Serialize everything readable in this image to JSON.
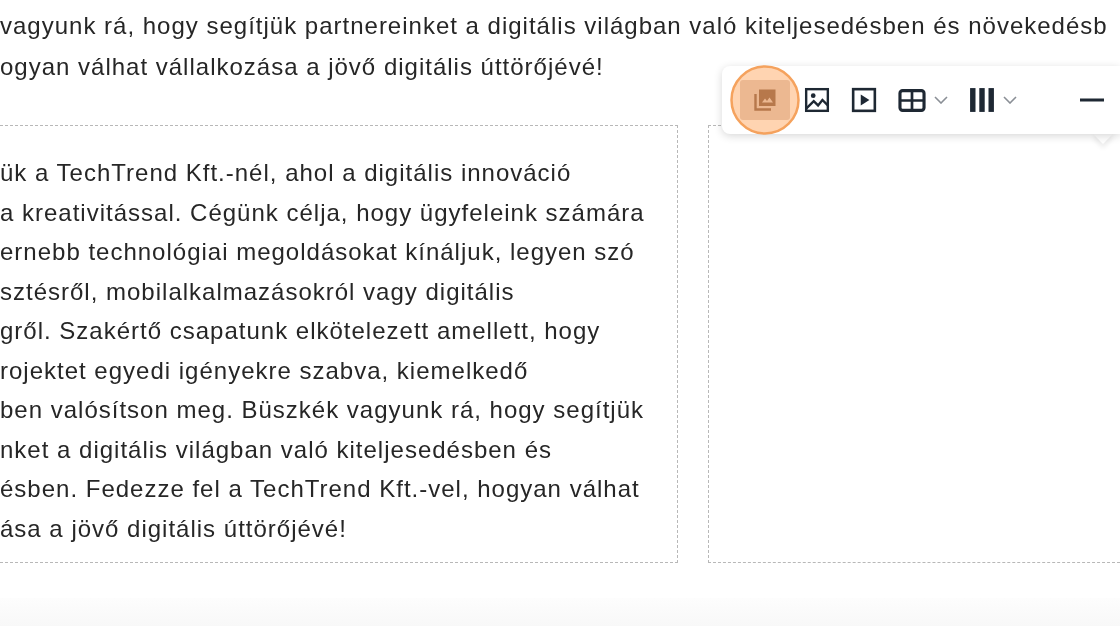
{
  "intro_lines": [
    "vagyunk rá, hogy segítjük partnereinket a digitális világban való kiteljesedésben és növekedésb",
    "ogyan válhat vállalkozása a jövő digitális úttörőjévé!"
  ],
  "columns": [
    {
      "kind": "text",
      "lines": [
        "ük a TechTrend Kft.-nél, ahol a digitális innováció",
        "a kreativitással. Cégünk célja, hogy ügyfeleink számára",
        "ernebb technológiai megoldásokat kínáljuk, legyen szó",
        "sztésről, mobilalkalmazásokról vagy digitális",
        "gről. Szakértő csapatunk elkötelezett amellett, hogy",
        "rojektet egyedi igényekre szabva, kiemelkedő",
        "ben valósítson meg. Büszkék vagyunk rá, hogy segítjük",
        "nket a digitális világban való kiteljesedésben és",
        "ésben. Fedezze fel a TechTrend Kft.-vel, hogyan válhat",
        "ása a jövő digitális úttörőjévé!"
      ]
    },
    {
      "kind": "empty"
    }
  ],
  "toolbar": {
    "items": [
      {
        "kind": "gallery",
        "selected": true,
        "highlighted": true,
        "dropdown": false
      },
      {
        "kind": "image",
        "selected": false,
        "highlighted": false,
        "dropdown": false
      },
      {
        "kind": "video",
        "selected": false,
        "highlighted": false,
        "dropdown": false
      },
      {
        "kind": "table",
        "selected": false,
        "highlighted": false,
        "dropdown": true
      },
      {
        "kind": "columns",
        "selected": false,
        "highlighted": false,
        "dropdown": true
      },
      {
        "kind": "divider",
        "selected": false,
        "highlighted": false,
        "dropdown": false
      }
    ]
  }
}
